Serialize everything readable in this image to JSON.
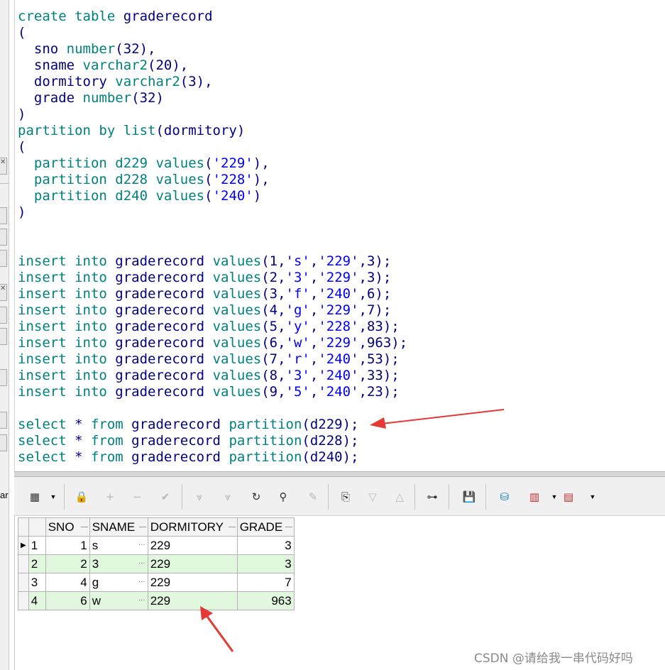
{
  "editor": {
    "lines": [
      [
        {
          "t": "create table ",
          "c": "kw"
        },
        {
          "t": "graderecord",
          "c": ""
        }
      ],
      [
        {
          "t": "(",
          "c": ""
        }
      ],
      [
        {
          "t": "  sno ",
          "c": ""
        },
        {
          "t": "number",
          "c": "kw"
        },
        {
          "t": "(32),",
          "c": ""
        }
      ],
      [
        {
          "t": "  sname ",
          "c": ""
        },
        {
          "t": "varchar2",
          "c": "kw"
        },
        {
          "t": "(20),",
          "c": ""
        }
      ],
      [
        {
          "t": "  dormitory ",
          "c": ""
        },
        {
          "t": "varchar2",
          "c": "kw"
        },
        {
          "t": "(3),",
          "c": ""
        }
      ],
      [
        {
          "t": "  grade ",
          "c": ""
        },
        {
          "t": "number",
          "c": "kw"
        },
        {
          "t": "(32)",
          "c": ""
        }
      ],
      [
        {
          "t": ")",
          "c": ""
        }
      ],
      [
        {
          "t": "partition by list",
          "c": "kw"
        },
        {
          "t": "(dormitory)",
          "c": ""
        }
      ],
      [
        {
          "t": "(",
          "c": ""
        }
      ],
      [
        {
          "t": "  partition d229 values",
          "c": "kw"
        },
        {
          "t": "(",
          "c": ""
        },
        {
          "t": "'229'",
          "c": "str"
        },
        {
          "t": "),",
          "c": ""
        }
      ],
      [
        {
          "t": "  partition d228 values",
          "c": "kw"
        },
        {
          "t": "(",
          "c": ""
        },
        {
          "t": "'228'",
          "c": "str"
        },
        {
          "t": "),",
          "c": ""
        }
      ],
      [
        {
          "t": "  partition d240 values",
          "c": "kw"
        },
        {
          "t": "(",
          "c": ""
        },
        {
          "t": "'240'",
          "c": "str"
        },
        {
          "t": ")",
          "c": ""
        }
      ],
      [
        {
          "t": ")",
          "c": ""
        }
      ],
      [],
      [],
      [
        {
          "t": "insert into ",
          "c": "kw"
        },
        {
          "t": "graderecord ",
          "c": ""
        },
        {
          "t": "values",
          "c": "kw"
        },
        {
          "t": "(1,",
          "c": ""
        },
        {
          "t": "'s'",
          "c": "str"
        },
        {
          "t": ",",
          "c": ""
        },
        {
          "t": "'229'",
          "c": "str"
        },
        {
          "t": ",3);",
          "c": ""
        }
      ],
      [
        {
          "t": "insert into ",
          "c": "kw"
        },
        {
          "t": "graderecord ",
          "c": ""
        },
        {
          "t": "values",
          "c": "kw"
        },
        {
          "t": "(2,",
          "c": ""
        },
        {
          "t": "'3'",
          "c": "str"
        },
        {
          "t": ",",
          "c": ""
        },
        {
          "t": "'229'",
          "c": "str"
        },
        {
          "t": ",3);",
          "c": ""
        }
      ],
      [
        {
          "t": "insert into ",
          "c": "kw"
        },
        {
          "t": "graderecord ",
          "c": ""
        },
        {
          "t": "values",
          "c": "kw"
        },
        {
          "t": "(3,",
          "c": ""
        },
        {
          "t": "'f'",
          "c": "str"
        },
        {
          "t": ",",
          "c": ""
        },
        {
          "t": "'240'",
          "c": "str"
        },
        {
          "t": ",6);",
          "c": ""
        }
      ],
      [
        {
          "t": "insert into ",
          "c": "kw"
        },
        {
          "t": "graderecord ",
          "c": ""
        },
        {
          "t": "values",
          "c": "kw"
        },
        {
          "t": "(4,",
          "c": ""
        },
        {
          "t": "'g'",
          "c": "str"
        },
        {
          "t": ",",
          "c": ""
        },
        {
          "t": "'229'",
          "c": "str"
        },
        {
          "t": ",7);",
          "c": ""
        }
      ],
      [
        {
          "t": "insert into ",
          "c": "kw"
        },
        {
          "t": "graderecord ",
          "c": ""
        },
        {
          "t": "values",
          "c": "kw"
        },
        {
          "t": "(5,",
          "c": ""
        },
        {
          "t": "'y'",
          "c": "str"
        },
        {
          "t": ",",
          "c": ""
        },
        {
          "t": "'228'",
          "c": "str"
        },
        {
          "t": ",83);",
          "c": ""
        }
      ],
      [
        {
          "t": "insert into ",
          "c": "kw"
        },
        {
          "t": "graderecord ",
          "c": ""
        },
        {
          "t": "values",
          "c": "kw"
        },
        {
          "t": "(6,",
          "c": ""
        },
        {
          "t": "'w'",
          "c": "str"
        },
        {
          "t": ",",
          "c": ""
        },
        {
          "t": "'229'",
          "c": "str"
        },
        {
          "t": ",963);",
          "c": ""
        }
      ],
      [
        {
          "t": "insert into ",
          "c": "kw"
        },
        {
          "t": "graderecord ",
          "c": ""
        },
        {
          "t": "values",
          "c": "kw"
        },
        {
          "t": "(7,",
          "c": ""
        },
        {
          "t": "'r'",
          "c": "str"
        },
        {
          "t": ",",
          "c": ""
        },
        {
          "t": "'240'",
          "c": "str"
        },
        {
          "t": ",53);",
          "c": ""
        }
      ],
      [
        {
          "t": "insert into ",
          "c": "kw"
        },
        {
          "t": "graderecord ",
          "c": ""
        },
        {
          "t": "values",
          "c": "kw"
        },
        {
          "t": "(8,",
          "c": ""
        },
        {
          "t": "'3'",
          "c": "str"
        },
        {
          "t": ",",
          "c": ""
        },
        {
          "t": "'240'",
          "c": "str"
        },
        {
          "t": ",33);",
          "c": ""
        }
      ],
      [
        {
          "t": "insert into ",
          "c": "kw"
        },
        {
          "t": "graderecord ",
          "c": ""
        },
        {
          "t": "values",
          "c": "kw"
        },
        {
          "t": "(9,",
          "c": ""
        },
        {
          "t": "'5'",
          "c": "str"
        },
        {
          "t": ",",
          "c": ""
        },
        {
          "t": "'240'",
          "c": "str"
        },
        {
          "t": ",23);",
          "c": ""
        }
      ],
      [],
      [
        {
          "t": "select ",
          "c": "kw"
        },
        {
          "t": "* ",
          "c": ""
        },
        {
          "t": "from ",
          "c": "kw"
        },
        {
          "t": "graderecord ",
          "c": ""
        },
        {
          "t": "partition",
          "c": "kw"
        },
        {
          "t": "(d229);",
          "c": ""
        }
      ],
      [
        {
          "t": "select ",
          "c": "kw"
        },
        {
          "t": "* ",
          "c": ""
        },
        {
          "t": "from ",
          "c": "kw"
        },
        {
          "t": "graderecord ",
          "c": ""
        },
        {
          "t": "partition",
          "c": "kw"
        },
        {
          "t": "(d228);",
          "c": ""
        }
      ],
      [
        {
          "t": "select ",
          "c": "kw"
        },
        {
          "t": "* ",
          "c": ""
        },
        {
          "t": "from ",
          "c": "kw"
        },
        {
          "t": "graderecord ",
          "c": ""
        },
        {
          "t": "partition",
          "c": "kw"
        },
        {
          "t": "(d240);",
          "c": ""
        }
      ]
    ]
  },
  "toolbar": {
    "items": [
      {
        "name": "grid-view-icon",
        "glyph": "▦",
        "disabled": false
      },
      {
        "name": "lock-icon",
        "glyph": "🔒",
        "disabled": false
      },
      {
        "name": "add-record-icon",
        "glyph": "+",
        "disabled": true
      },
      {
        "name": "delete-record-icon",
        "glyph": "−",
        "disabled": true
      },
      {
        "name": "post-changes-icon",
        "glyph": "✔",
        "disabled": true
      },
      {
        "name": "next-page-icon",
        "glyph": "⩔",
        "disabled": true
      },
      {
        "name": "last-page-icon",
        "glyph": "⩔",
        "disabled": true
      },
      {
        "name": "refresh-icon",
        "glyph": "↻",
        "disabled": false
      },
      {
        "name": "find-binoculars-icon",
        "glyph": "⚲",
        "disabled": false
      },
      {
        "name": "clear-icon",
        "glyph": "✎",
        "disabled": true
      },
      {
        "name": "query-by-example-icon",
        "glyph": "⎘",
        "disabled": false
      },
      {
        "name": "filter-down-icon",
        "glyph": "▽",
        "disabled": true
      },
      {
        "name": "filter-up-icon",
        "glyph": "△",
        "disabled": true
      },
      {
        "name": "explain-plan-icon",
        "glyph": "⊶",
        "disabled": false
      },
      {
        "name": "save-icon",
        "glyph": "💾",
        "disabled": false
      },
      {
        "name": "export-icon",
        "glyph": "⛁",
        "disabled": false
      },
      {
        "name": "chart-icon",
        "glyph": "▥",
        "disabled": false
      },
      {
        "name": "table-red-icon",
        "glyph": "▤",
        "disabled": false
      }
    ]
  },
  "grid": {
    "columns": [
      "SNO",
      "SNAME",
      "DORMITORY",
      "GRADE"
    ],
    "rows": [
      {
        "num": "1",
        "sno": "1",
        "sname": "s",
        "dorm": "229",
        "grade": "3"
      },
      {
        "num": "2",
        "sno": "2",
        "sname": "3",
        "dorm": "229",
        "grade": "3"
      },
      {
        "num": "3",
        "sno": "4",
        "sname": "g",
        "dorm": "229",
        "grade": "7"
      },
      {
        "num": "4",
        "sno": "6",
        "sname": "w",
        "dorm": "229",
        "grade": "963"
      }
    ],
    "current_row_marker": "▶",
    "cell_ellipsis": "…",
    "alt_row_color": "#e2f8de"
  },
  "left_strip": {
    "text": "ar"
  },
  "watermark": "CSDN @请给我一串代码好吗",
  "annotation_color": "#e53935"
}
